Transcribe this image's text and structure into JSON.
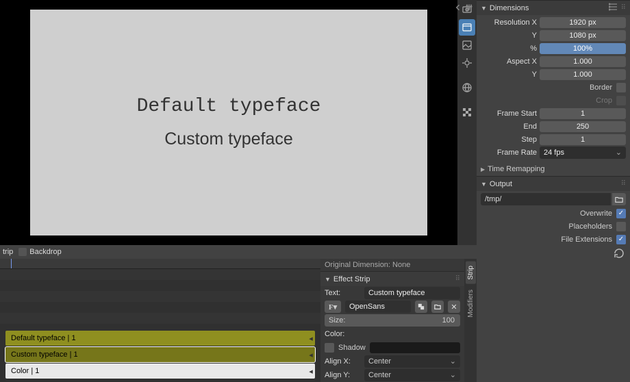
{
  "preview": {
    "line1": "Default typeface",
    "line2": "Custom typeface"
  },
  "midbar": {
    "strip_tab": "trip",
    "backdrop_label": "Backdrop"
  },
  "dimensions_panel": {
    "title": "Dimensions",
    "resolution_x_label": "Resolution X",
    "resolution_x": "1920 px",
    "resolution_y_label": "Y",
    "resolution_y": "1080 px",
    "percent_label": "%",
    "percent_val": "100%",
    "aspect_x_label": "Aspect X",
    "aspect_x": "1.000",
    "aspect_y_label": "Y",
    "aspect_y": "1.000",
    "border_label": "Border",
    "crop_label": "Crop",
    "frame_start_label": "Frame Start",
    "frame_start": "1",
    "frame_end_label": "End",
    "frame_end": "250",
    "frame_step_label": "Step",
    "frame_step": "1",
    "frame_rate_label": "Frame Rate",
    "frame_rate": "24 fps",
    "time_remapping": "Time Remapping"
  },
  "output_panel": {
    "title": "Output",
    "path": "/tmp/",
    "overwrite": "Overwrite",
    "placeholders": "Placeholders",
    "file_extensions": "File Extensions"
  },
  "timeline_strips": {
    "s1": "Default typeface | 1",
    "s2": "Custom typeface | 1",
    "s3": "Color | 1"
  },
  "effect_strip": {
    "orig_dim": "Original Dimension: None",
    "title": "Effect Strip",
    "text_lbl": "Text:",
    "text_val": "Custom typeface",
    "font_val": "OpenSans",
    "size_lbl": "Size:",
    "size_val": "100",
    "color_lbl": "Color:",
    "shadow_lbl": "Shadow",
    "alignx_lbl": "Align X:",
    "alignx_val": "Center",
    "aligny_lbl": "Align Y:",
    "aligny_val": "Center"
  },
  "side_tabs": {
    "strip": "Strip",
    "modifiers": "Modifiers"
  }
}
